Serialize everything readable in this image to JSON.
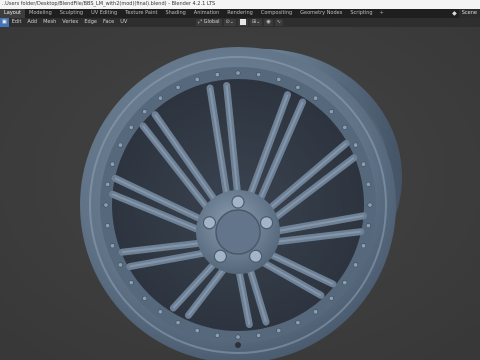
{
  "window": {
    "title": "..Users folder/Desktop/BlendFile/BBS_LM_with2(mod)(final).blend) - Blender 4.2.1 LTS"
  },
  "workspaces": {
    "tabs": [
      "Layout",
      "Modeling",
      "Sculpting",
      "UV Editing",
      "Texture Paint",
      "Shading",
      "Animation",
      "Rendering",
      "Compositing",
      "Geometry Nodes",
      "Scripting"
    ],
    "active": "Layout",
    "add": "+",
    "scene_label": "Scene"
  },
  "header": {
    "menus": [
      "Edit",
      "Add",
      "Mesh",
      "Vertex",
      "Edge",
      "Face",
      "UV"
    ],
    "first_icon": "▣",
    "transform_orientation": "Global",
    "dropdown_arrow": "⌄"
  },
  "colors": {
    "wheel": "#5f738a",
    "background": "#3d3d3d",
    "accent": "#4772b3"
  }
}
